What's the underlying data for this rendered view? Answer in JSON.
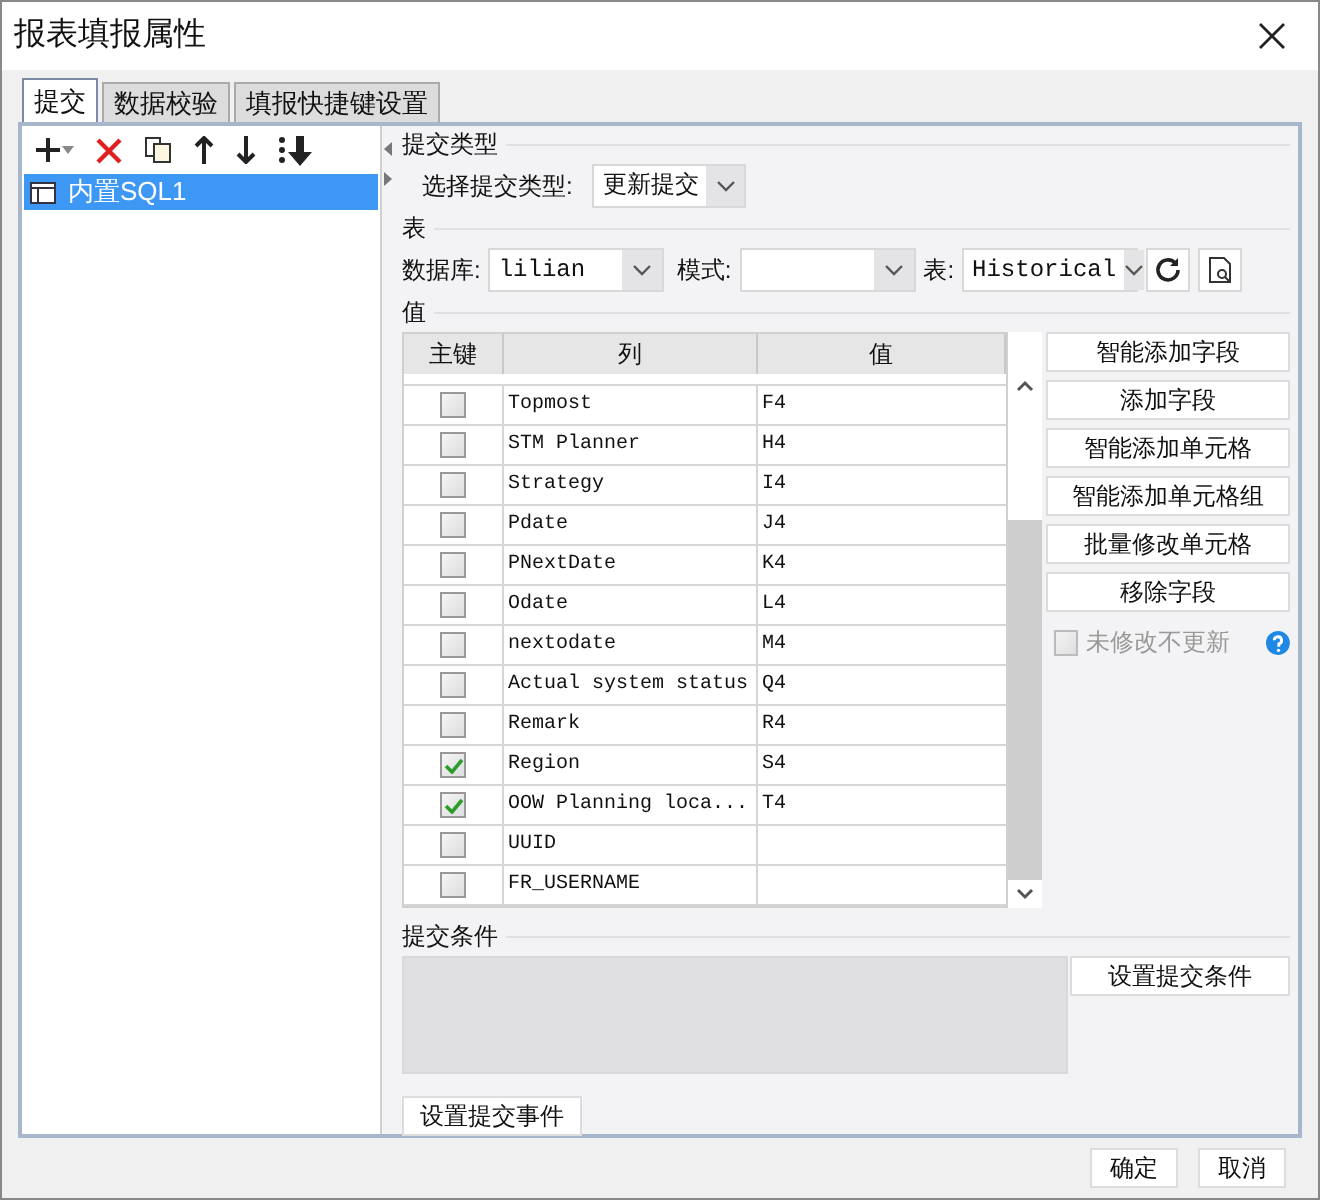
{
  "window": {
    "title": "报表填报属性"
  },
  "tabs": [
    {
      "label": "提交",
      "selected": true
    },
    {
      "label": "数据校验",
      "selected": false
    },
    {
      "label": "填报快捷键设置",
      "selected": false
    }
  ],
  "tree": {
    "items": [
      {
        "label": "内置SQL1",
        "selected": true
      }
    ]
  },
  "submit_type": {
    "heading": "提交类型",
    "label": "选择提交类型:",
    "value": "更新提交"
  },
  "table_section": {
    "heading": "表",
    "database_label": "数据库:",
    "database": "lilian",
    "schema_label": "模式:",
    "table_label": "表:",
    "table": "Historical"
  },
  "values": {
    "heading": "值",
    "columns": [
      "主键",
      "列",
      "值"
    ],
    "rows": [
      {
        "column": "Topmost",
        "value": "F4",
        "checked": false
      },
      {
        "column": "STM Planner",
        "value": "H4",
        "checked": false
      },
      {
        "column": "Strategy",
        "value": "I4",
        "checked": false
      },
      {
        "column": "Pdate",
        "value": "J4",
        "checked": false
      },
      {
        "column": "PNextDate",
        "value": "K4",
        "checked": false
      },
      {
        "column": "Odate",
        "value": "L4",
        "checked": false
      },
      {
        "column": "nextodate",
        "value": "M4",
        "checked": false
      },
      {
        "column": "Actual system status",
        "value": "Q4",
        "checked": false
      },
      {
        "column": "Remark",
        "value": "R4",
        "checked": false
      },
      {
        "column": "Region",
        "value": "S4",
        "checked": true
      },
      {
        "column": "OOW Planning loca...",
        "value": "T4",
        "checked": true
      },
      {
        "column": "UUID",
        "checked": false
      },
      {
        "column": "FR_USERNAME",
        "checked": false
      }
    ],
    "buttons": [
      "智能添加字段",
      "添加字段",
      "智能添加单元格",
      "智能添加单元格组",
      "批量修改单元格",
      "移除字段"
    ],
    "no_update": {
      "label": "未修改不更新",
      "checked": false,
      "disabled": true
    }
  },
  "condition": {
    "heading": "提交条件",
    "button": "设置提交条件"
  },
  "event_button": "设置提交事件",
  "footer_buttons": [
    "确定",
    "取消"
  ]
}
